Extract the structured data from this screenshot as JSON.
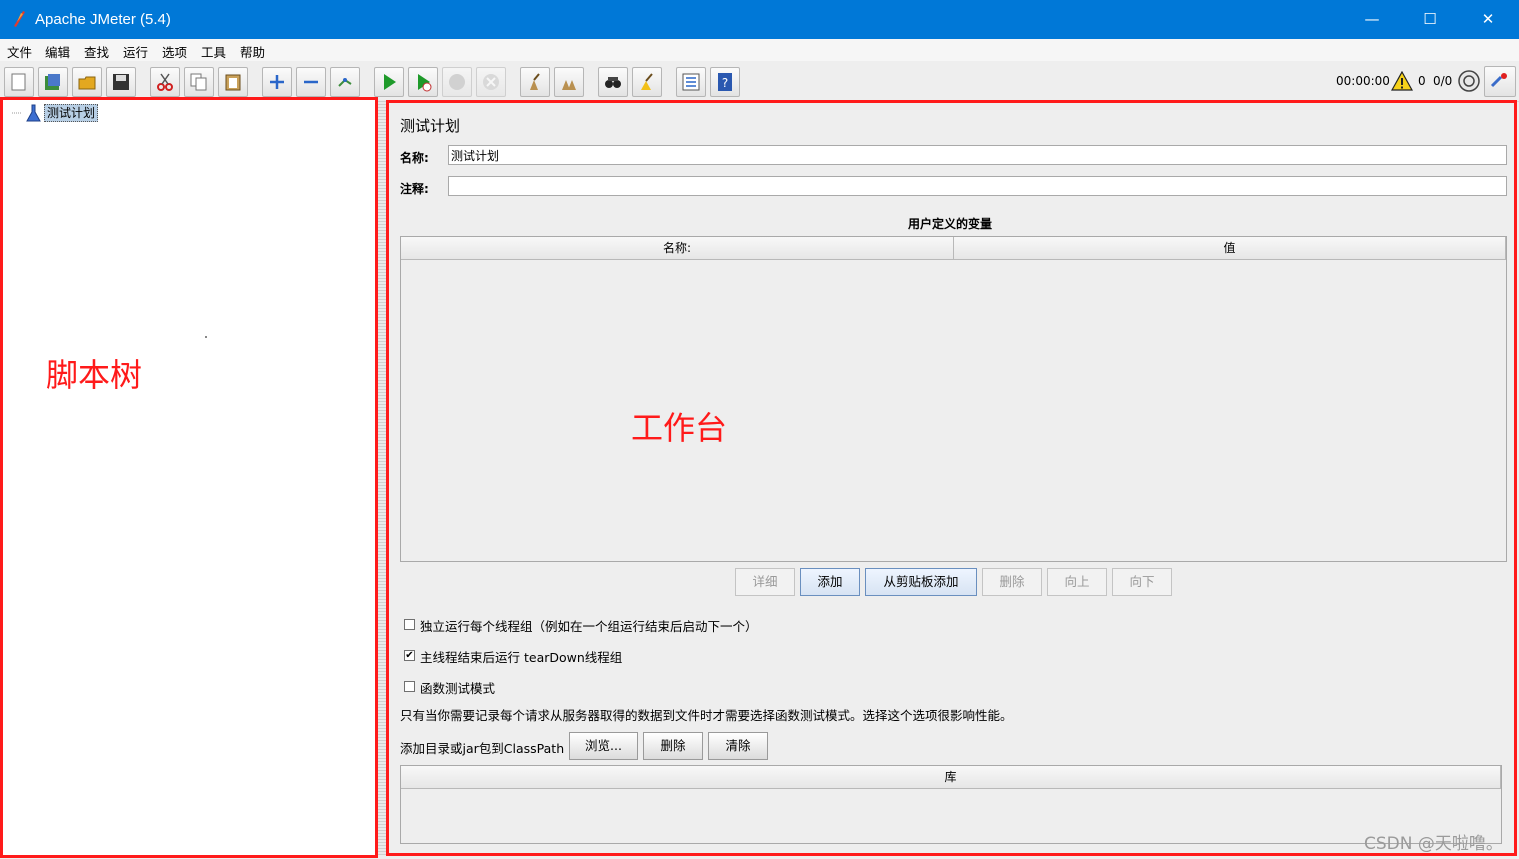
{
  "window": {
    "title": "Apache JMeter (5.4)",
    "minimize": "—",
    "maximize": "☐",
    "close": "✕"
  },
  "menu": [
    "文件",
    "编辑",
    "查找",
    "运行",
    "选项",
    "工具",
    "帮助"
  ],
  "toolbar": {
    "icons": [
      "new-icon",
      "templates-icon",
      "open-icon",
      "save-icon",
      "cut-icon",
      "copy-icon",
      "paste-icon",
      "expand-icon",
      "collapse-icon",
      "toggle-icon",
      "start-icon",
      "start-no-pause-icon",
      "stop-icon",
      "shutdown-icon",
      "clear-icon",
      "clear-all-icon",
      "search-icon",
      "reset-search-icon",
      "function-helper-icon",
      "help-icon"
    ],
    "timer": "00:00:00",
    "warning_count": "0",
    "threads": "0/0"
  },
  "tree": {
    "root_label": "测试计划"
  },
  "annotations": {
    "tree": "脚本树",
    "workbench": "工作台"
  },
  "panel": {
    "heading": "测试计划",
    "name_label": "名称:",
    "name_value": "测试计划",
    "comment_label": "注释:",
    "comment_value": "",
    "variables_title": "用户定义的变量",
    "col_name": "名称:",
    "col_value": "值",
    "buttons": {
      "detail": "详细",
      "add": "添加",
      "add_from_clipboard": "从剪贴板添加",
      "delete": "删除",
      "up": "向上",
      "down": "向下"
    },
    "options": {
      "serialize": "独立运行每个线程组（例如在一个组运行结束后启动下一个）",
      "serialize_checked": false,
      "teardown": "主线程结束后运行 tearDown线程组",
      "teardown_checked": true,
      "functional": "函数测试模式",
      "functional_checked": false,
      "functional_note": "只有当你需要记录每个请求从服务器取得的数据到文件时才需要选择函数测试模式。选择这个选项很影响性能。"
    },
    "classpath": {
      "label": "添加目录或jar包到ClassPath",
      "browse": "浏览...",
      "delete": "删除",
      "clear": "清除",
      "lib_header": "库"
    }
  },
  "watermark": "CSDN @天啦噜。",
  "colors": {
    "titlebar": "#0078d7",
    "annotation": "#ff1a1a"
  }
}
